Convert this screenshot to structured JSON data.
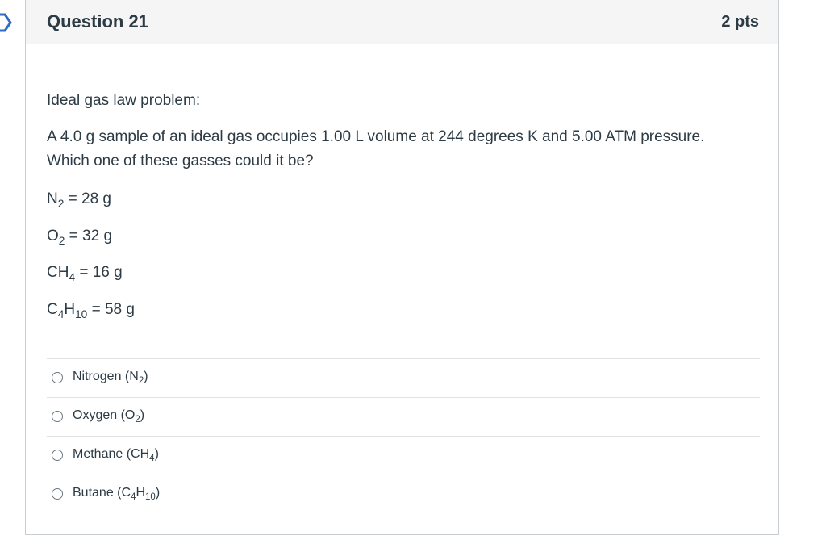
{
  "question": {
    "title": "Question 21",
    "points": "2 pts",
    "intro": "Ideal gas law problem:",
    "prompt_line1": "A 4.0 g sample of an ideal gas occupies 1.00 L volume at 244 degrees K and 5.00 ATM pressure.",
    "prompt_line2": "Which one of these gasses could it be?",
    "molar_masses": [
      {
        "formula_a": "N",
        "sub_a": "2",
        "formula_b": "",
        "sub_b": "",
        "value": " = 28 g"
      },
      {
        "formula_a": "O",
        "sub_a": "2",
        "formula_b": "",
        "sub_b": "",
        "value": " = 32 g"
      },
      {
        "formula_a": "CH",
        "sub_a": "4",
        "formula_b": "",
        "sub_b": "",
        "value": " = 16 g"
      },
      {
        "formula_a": "C",
        "sub_a": "4",
        "formula_b": "H",
        "sub_b": "10",
        "value": " = 58 g"
      }
    ]
  },
  "answers": [
    {
      "name": "Nitrogen (N",
      "sub_a": "2",
      "mid": "",
      "sub_b": "",
      "end": ")"
    },
    {
      "name": "Oxygen (O",
      "sub_a": "2",
      "mid": "",
      "sub_b": "",
      "end": ")"
    },
    {
      "name": "Methane (CH",
      "sub_a": "4",
      "mid": "",
      "sub_b": "",
      "end": ")"
    },
    {
      "name": "Butane (C",
      "sub_a": "4",
      "mid": "H",
      "sub_b": "10",
      "end": ")"
    }
  ],
  "colors": {
    "header_bg": "#f5f5f5",
    "border": "#c7cdd1",
    "text": "#2d3b45"
  },
  "icons": {
    "flag": "flag-outline-icon",
    "radio": "radio-unchecked-icon"
  }
}
